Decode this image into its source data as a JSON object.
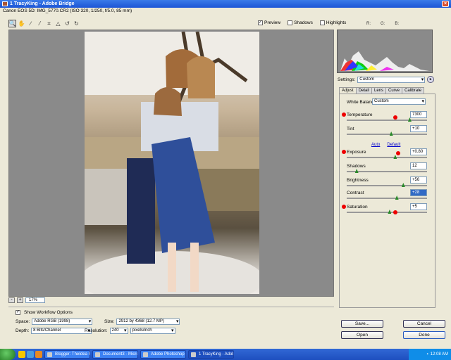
{
  "window": {
    "title": "1 TracyKing - Adobe Bridge"
  },
  "camera_info": "Canon EOS 5D:  IMG_5770.CR2  (ISO 320, 1/250, f/5.0, 85 mm)",
  "preview_opts": {
    "preview": "Preview",
    "shadows": "Shadows",
    "highlights": "Highlights"
  },
  "rgb": {
    "r": "R:",
    "g": "G:",
    "b": "B:"
  },
  "settings": {
    "label": "Settings:",
    "value": "Custom",
    "menu": "▸"
  },
  "tabs": [
    "Adjust",
    "Detail",
    "Lens",
    "Curve",
    "Calibrate"
  ],
  "adjust": {
    "wb_label": "White Balance:",
    "wb_value": "Custom",
    "temperature": {
      "label": "Temperature",
      "value": "7300",
      "position": 0.78
    },
    "tint": {
      "label": "Tint",
      "value": "+10",
      "position": 0.55
    },
    "auto": "Auto",
    "default": "Default",
    "exposure": {
      "label": "Exposure",
      "value": "+0.80",
      "position": 0.6
    },
    "shadows": {
      "label": "Shadows",
      "value": "12",
      "position": 0.12
    },
    "brightness": {
      "label": "Brightness",
      "value": "+56",
      "position": 0.7
    },
    "contrast": {
      "label": "Contrast",
      "value": "+28",
      "position": 0.62
    },
    "saturation": {
      "label": "Saturation",
      "value": "+5",
      "position": 0.53
    }
  },
  "zoom": {
    "minus": "-",
    "plus": "+",
    "value": "17%"
  },
  "workflow": {
    "show_label": "Show Workflow Options",
    "space_label": "Space:",
    "space_value": "Adobe RGB (1998)",
    "depth_label": "Depth:",
    "depth_value": "8 Bits/Channel",
    "size_label": "Size:",
    "size_value": "2912 by 4368  (12.7 MP)",
    "resolution_label": "Resolution:",
    "resolution_value": "240",
    "resolution_unit": "pixels/inch"
  },
  "buttons": {
    "save": "Save...",
    "cancel": "Cancel",
    "open": "Open",
    "done": "Done"
  },
  "taskbar": {
    "tasks": [
      "Blogger: TheIdea R...",
      "Document3 - Micro...",
      "Adobe Photoshop",
      "1 TracyKing - Adob..."
    ],
    "clock": "12:08 AM"
  }
}
